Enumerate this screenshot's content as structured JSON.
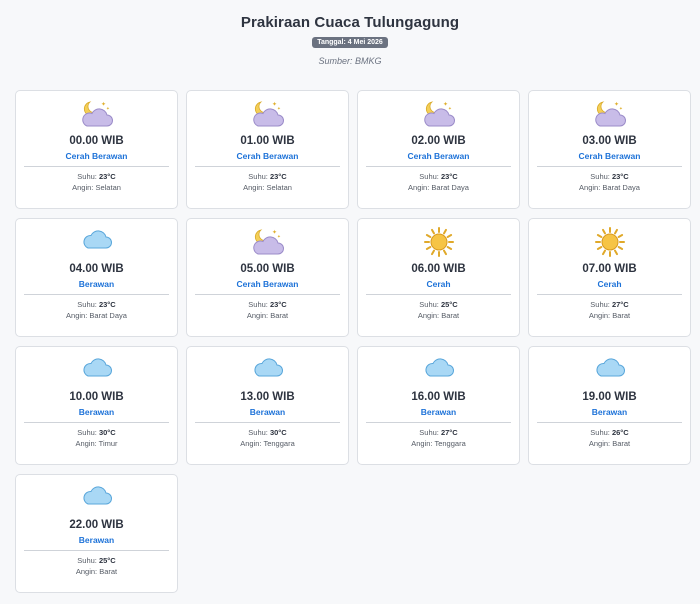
{
  "header": {
    "title": "Prakiraan Cuaca Tulungagung",
    "date": "Tanggal: 4 Mei 2026",
    "source": "Sumber: BMKG"
  },
  "labels": {
    "suhu": "Suhu:",
    "angin": "Angin:"
  },
  "forecasts": [
    {
      "time": "00.00 WIB",
      "condition": "Cerah Berawan",
      "icon": "moon-cloud-icon",
      "temp": "23°C",
      "wind": "Selatan"
    },
    {
      "time": "01.00 WIB",
      "condition": "Cerah Berawan",
      "icon": "moon-cloud-icon",
      "temp": "23°C",
      "wind": "Selatan"
    },
    {
      "time": "02.00 WIB",
      "condition": "Cerah Berawan",
      "icon": "moon-cloud-icon",
      "temp": "23°C",
      "wind": "Barat Daya"
    },
    {
      "time": "03.00 WIB",
      "condition": "Cerah Berawan",
      "icon": "moon-cloud-icon",
      "temp": "23°C",
      "wind": "Barat Daya"
    },
    {
      "time": "04.00 WIB",
      "condition": "Berawan",
      "icon": "cloud-icon",
      "temp": "23°C",
      "wind": "Barat Daya"
    },
    {
      "time": "05.00 WIB",
      "condition": "Cerah Berawan",
      "icon": "moon-cloud-icon",
      "temp": "23°C",
      "wind": "Barat"
    },
    {
      "time": "06.00 WIB",
      "condition": "Cerah",
      "icon": "sun-icon",
      "temp": "25°C",
      "wind": "Barat"
    },
    {
      "time": "07.00 WIB",
      "condition": "Cerah",
      "icon": "sun-icon",
      "temp": "27°C",
      "wind": "Barat"
    },
    {
      "time": "10.00 WIB",
      "condition": "Berawan",
      "icon": "cloud-icon",
      "temp": "30°C",
      "wind": "Timur"
    },
    {
      "time": "13.00 WIB",
      "condition": "Berawan",
      "icon": "cloud-icon",
      "temp": "30°C",
      "wind": "Tenggara"
    },
    {
      "time": "16.00 WIB",
      "condition": "Berawan",
      "icon": "cloud-icon",
      "temp": "27°C",
      "wind": "Tenggara"
    },
    {
      "time": "19.00 WIB",
      "condition": "Berawan",
      "icon": "cloud-icon",
      "temp": "26°C",
      "wind": "Barat"
    },
    {
      "time": "22.00 WIB",
      "condition": "Berawan",
      "icon": "cloud-icon",
      "temp": "25°C",
      "wind": "Barat"
    }
  ],
  "colors": {
    "accent": "#1d72d8",
    "cloud": "#a9d8f5",
    "night_cloud": "#c8bce8",
    "sun": "#f6c445",
    "moon": "#f4cf57"
  }
}
